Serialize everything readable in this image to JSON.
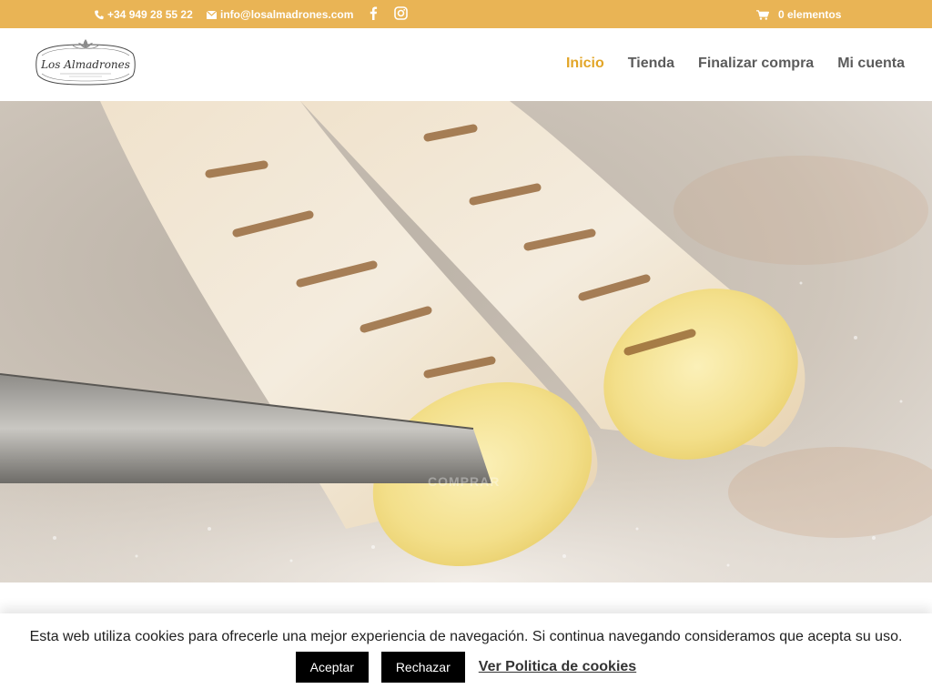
{
  "topbar": {
    "phone": "+34 949 28 55 22",
    "email": "info@losalmadrones.com",
    "social_icons": [
      "facebook-icon",
      "instagram-icon"
    ],
    "cart": "0 elementos",
    "background": "#e9b455"
  },
  "header": {
    "logo_text": "Los Almadrones",
    "nav": [
      {
        "label": "Inicio",
        "active": true
      },
      {
        "label": "Tienda",
        "active": false
      },
      {
        "label": "Finalizar compra",
        "active": false
      },
      {
        "label": "Mi cuenta",
        "active": false
      }
    ],
    "active_color": "#e2a527"
  },
  "hero": {
    "ghost_text": "COMPRAR"
  },
  "cookie_bar": {
    "message": "Esta web utiliza cookies para ofrecerle una mejor experiencia de navegación. Si continua navegando consideramos que acepta su uso.",
    "accept": "Aceptar",
    "reject": "Rechazar",
    "policy_link": "Ver Politica de cookies"
  }
}
